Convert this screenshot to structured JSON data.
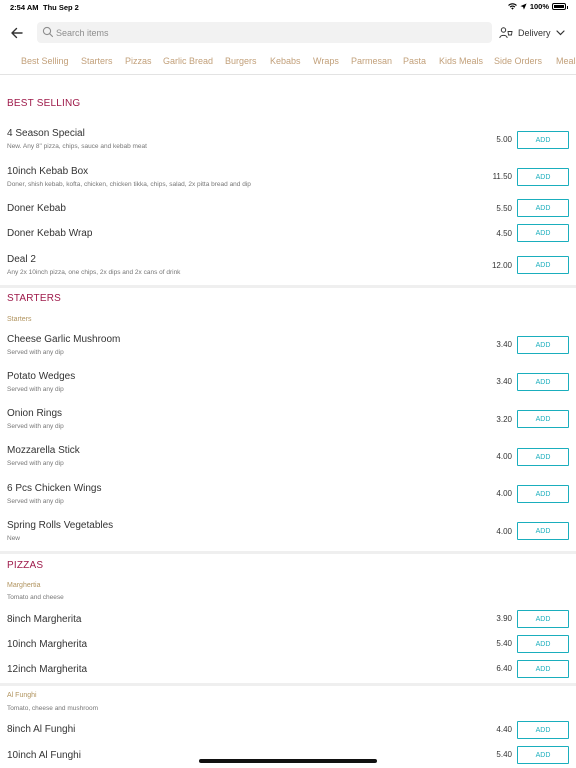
{
  "status_bar": {
    "time": "2:54 AM",
    "date": "Thu Sep 2",
    "battery": "100%",
    "battery_level": 1.0
  },
  "top_bar": {
    "search_placeholder": "Search items",
    "delivery_label": "Delivery"
  },
  "tabs": [
    {
      "label": "Best Selling",
      "active": true
    },
    {
      "label": "Starters"
    },
    {
      "label": "Pizzas"
    },
    {
      "label": "Garlic Bread"
    },
    {
      "label": "Burgers"
    },
    {
      "label": "Kebabs"
    },
    {
      "label": "Wraps"
    },
    {
      "label": "Parmesan"
    },
    {
      "label": "Pasta"
    },
    {
      "label": "Kids Meals"
    },
    {
      "label": "Side Orders"
    },
    {
      "label": "Meals"
    }
  ],
  "add_label": "ADD",
  "sections": [
    {
      "title": "BEST SELLING",
      "items": [
        {
          "name": "4 Season Special",
          "desc": "New. Any 8\" pizza, chips, sauce and kebab meat",
          "price": "5.00"
        },
        {
          "name": "10inch Kebab Box",
          "desc": "Doner, shish kebab, kofta, chicken, chicken tikka, chips, salad, 2x pitta bread and dip",
          "price": "11.50"
        },
        {
          "name": "Doner Kebab",
          "desc": "",
          "price": "5.50"
        },
        {
          "name": "Doner Kebab Wrap",
          "desc": "",
          "price": "4.50"
        },
        {
          "name": "Deal 2",
          "desc": "Any 2x 10inch pizza, one chips, 2x dips and 2x cans of drink",
          "price": "12.00"
        }
      ]
    },
    {
      "title": "STARTERS",
      "subtitle": "Starters",
      "items": [
        {
          "name": "Cheese Garlic Mushroom",
          "desc": "Served with any dip",
          "price": "3.40"
        },
        {
          "name": "Potato Wedges",
          "desc": "Served with any dip",
          "price": "3.40"
        },
        {
          "name": "Onion Rings",
          "desc": "Served with any dip",
          "price": "3.20"
        },
        {
          "name": "Mozzarella Stick",
          "desc": "Served with any dip",
          "price": "4.00"
        },
        {
          "name": "6 Pcs Chicken Wings",
          "desc": "Served with any dip",
          "price": "4.00"
        },
        {
          "name": "Spring Rolls Vegetables",
          "desc": "New",
          "price": "4.00"
        }
      ]
    },
    {
      "title": "PIZZAS",
      "groups": [
        {
          "subtitle": "Marghertia",
          "subdesc": "Tomato and cheese",
          "items": [
            {
              "name": "8inch Margherita",
              "price": "3.90"
            },
            {
              "name": "10inch Margherita",
              "price": "5.40"
            },
            {
              "name": "12inch Margherita",
              "price": "6.40"
            }
          ]
        },
        {
          "subtitle": "Al Funghi",
          "subdesc": "Tomato, cheese and mushroom",
          "items": [
            {
              "name": "8inch Al Funghi",
              "price": "4.40"
            },
            {
              "name": "10inch Al Funghi",
              "price": "5.40"
            }
          ]
        }
      ]
    }
  ],
  "colors": {
    "accent": "#1aaebd",
    "section_title": "#9e1a4a",
    "tab_text": "#c2a07a",
    "subtitle": "#b1945f"
  }
}
